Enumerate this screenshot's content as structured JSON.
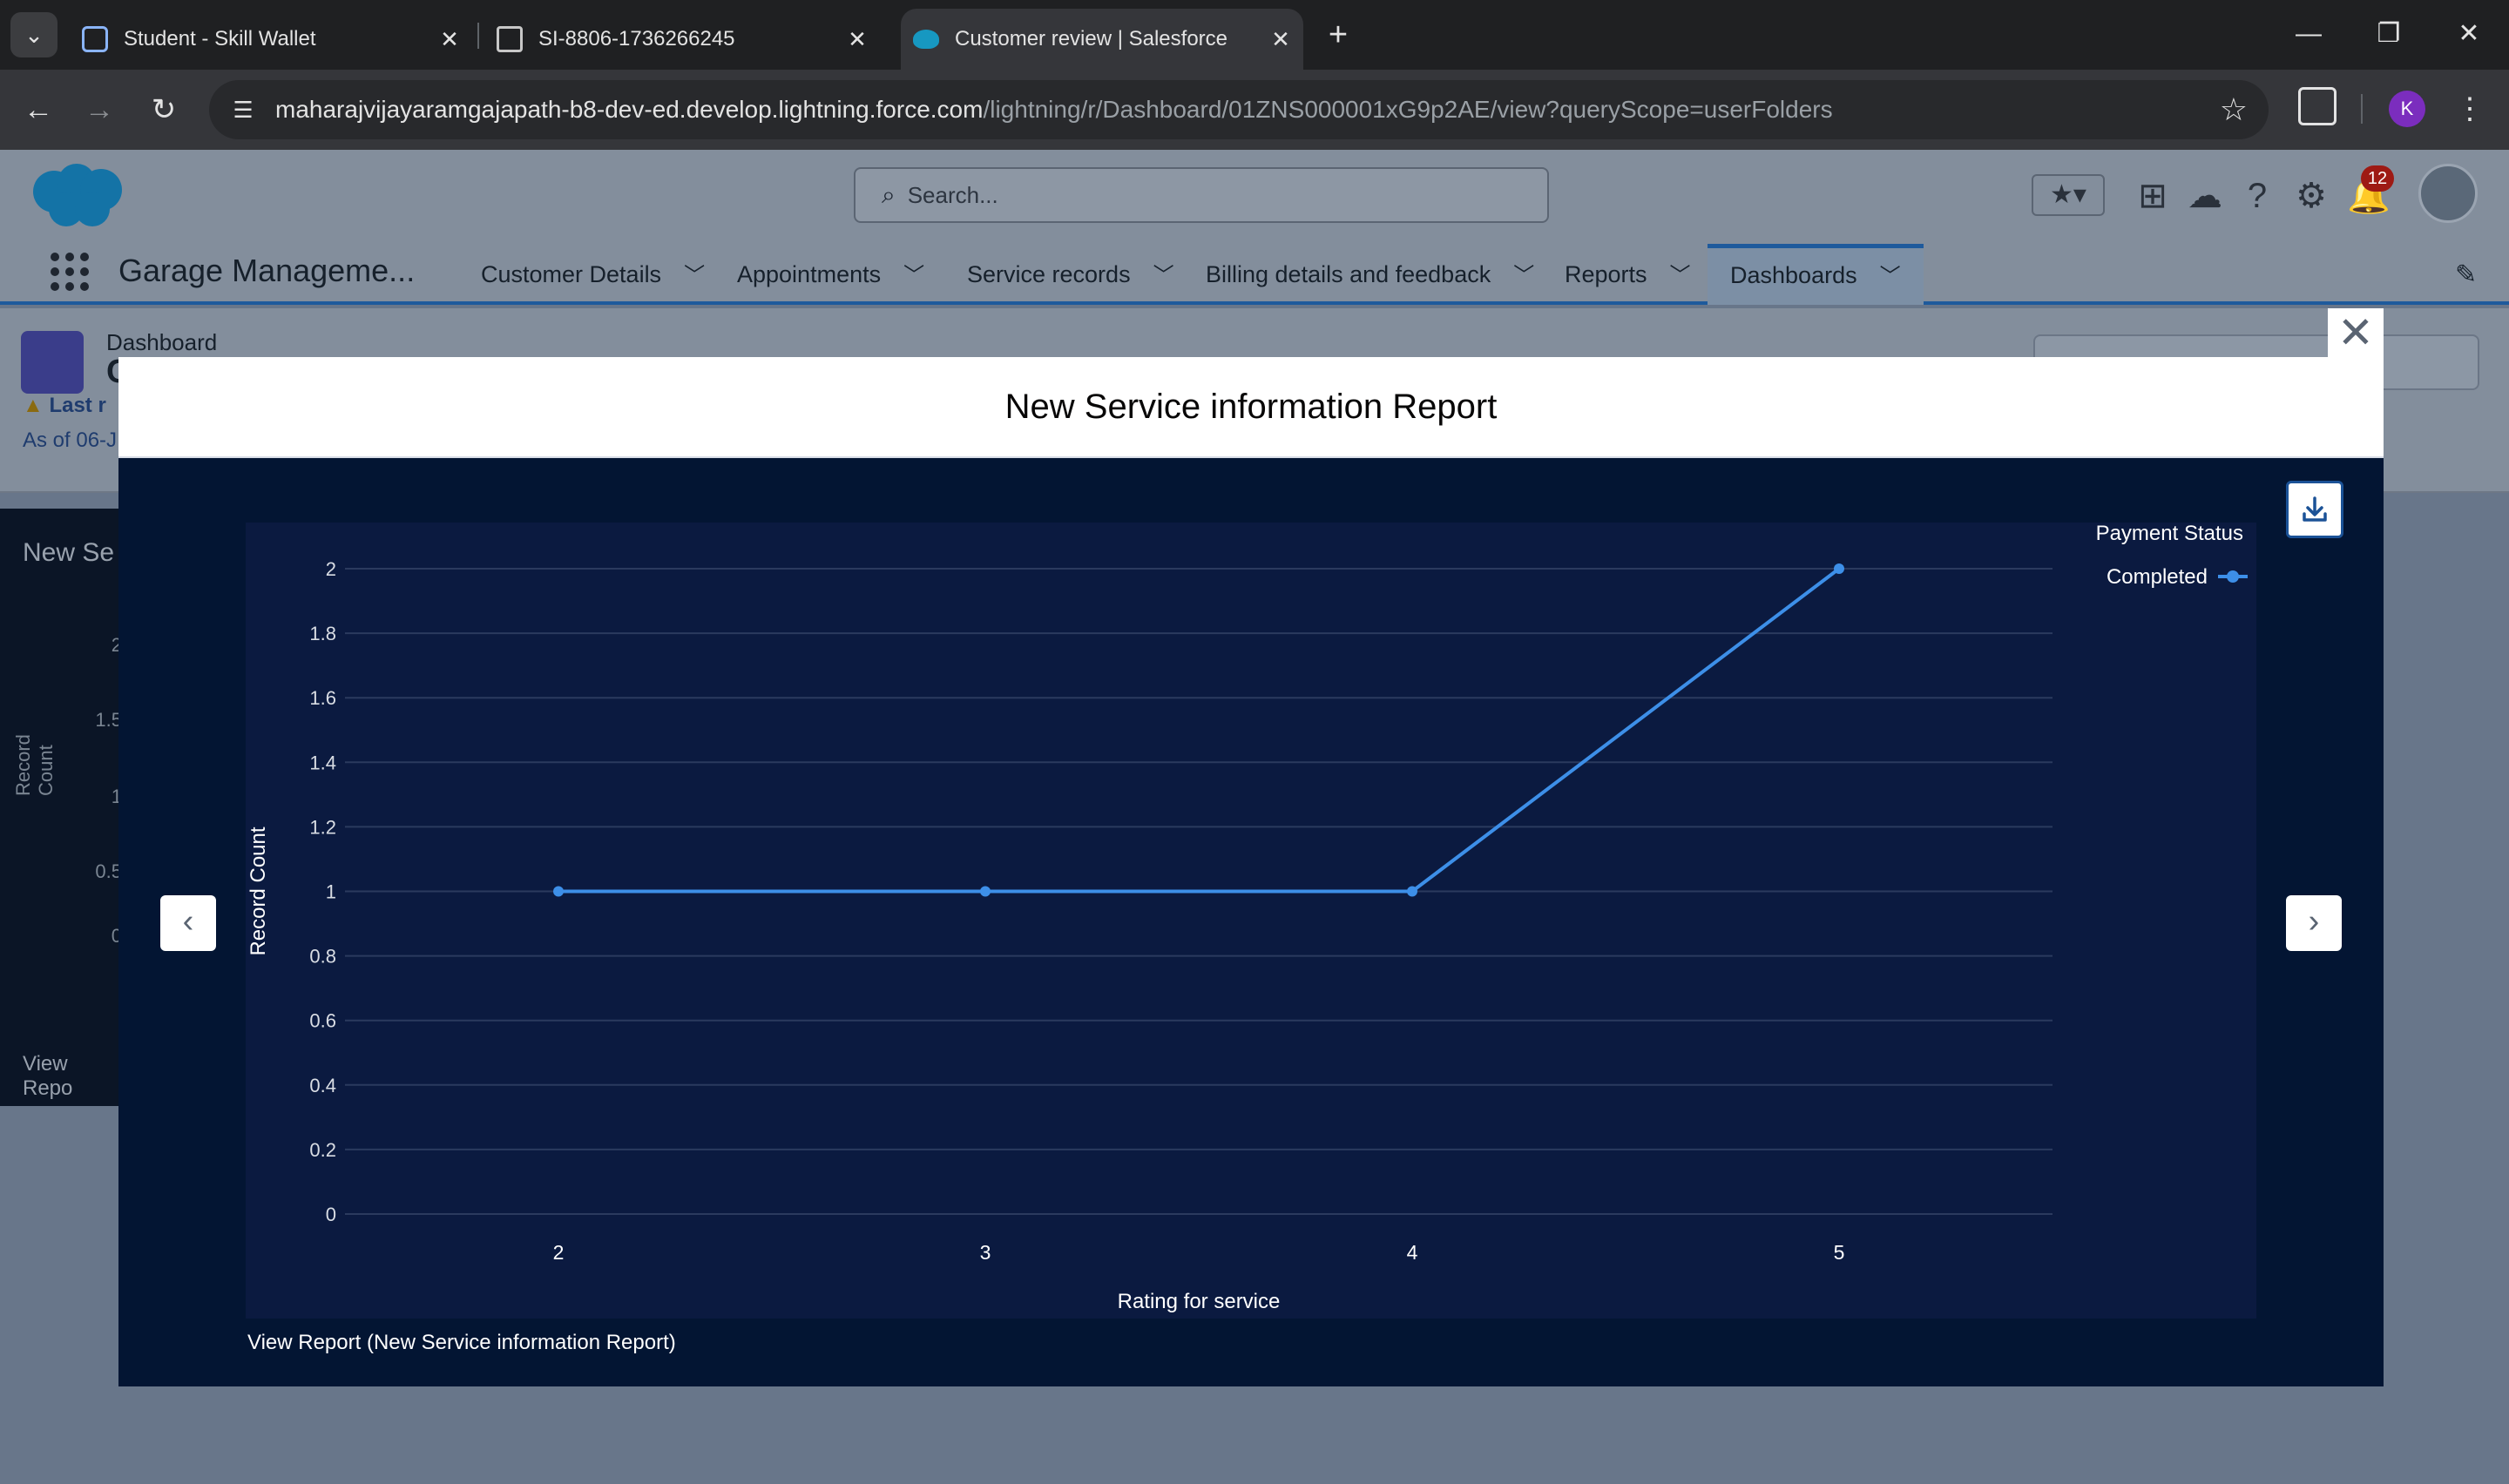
{
  "browser": {
    "tabs": [
      {
        "title": "Student - Skill Wallet"
      },
      {
        "title": "SI-8806-1736266245"
      },
      {
        "title": "Customer review | Salesforce"
      }
    ],
    "url_host": "maharajvijayaramgajapath-b8-dev-ed.develop.lightning.force.com",
    "url_path": "/lightning/r/Dashboard/01ZNS000001xG9p2AE/view?queryScope=userFolders",
    "profile_initial": "K"
  },
  "sf": {
    "search_placeholder": "Search...",
    "notification_count": "12",
    "app_name": "Garage Manageme...",
    "nav": [
      {
        "label": "Customer Details"
      },
      {
        "label": "Appointments"
      },
      {
        "label": "Service records"
      },
      {
        "label": "Billing details and feedback"
      },
      {
        "label": "Reports"
      },
      {
        "label": "Dashboards"
      }
    ],
    "dashboard_label": "Dashboard",
    "dashboard_title_fragment": "C",
    "last_refreshed_fragment": "Last r",
    "as_of_fragment": "As of 06-J",
    "bg_card": {
      "title_fragment": "New Se",
      "y_label": "Record Count",
      "ticks": [
        "2",
        "1.5",
        "1",
        "0.5",
        "0"
      ],
      "view_report_fragment": "View Repo"
    }
  },
  "modal": {
    "title": "New Service information Report",
    "view_report_link": "View Report (New Service information Report)"
  },
  "colors": {
    "series": "#3d8fe8",
    "chart_bg": "#0b1a40",
    "modal_bg": "#031533"
  },
  "chart_data": {
    "type": "line",
    "categories": [
      "2",
      "3",
      "4",
      "5"
    ],
    "series": [
      {
        "name": "Completed",
        "values": [
          1,
          1,
          1,
          2
        ]
      }
    ],
    "xlabel": "Rating for service",
    "ylabel": "Record Count",
    "legend_title": "Payment Status",
    "legend_position": "top-right",
    "ylim": [
      0,
      2
    ],
    "yticks": [
      "0",
      "0.2",
      "0.4",
      "0.6",
      "0.8",
      "1",
      "1.2",
      "1.4",
      "1.6",
      "1.8",
      "2"
    ],
    "grid": true
  }
}
